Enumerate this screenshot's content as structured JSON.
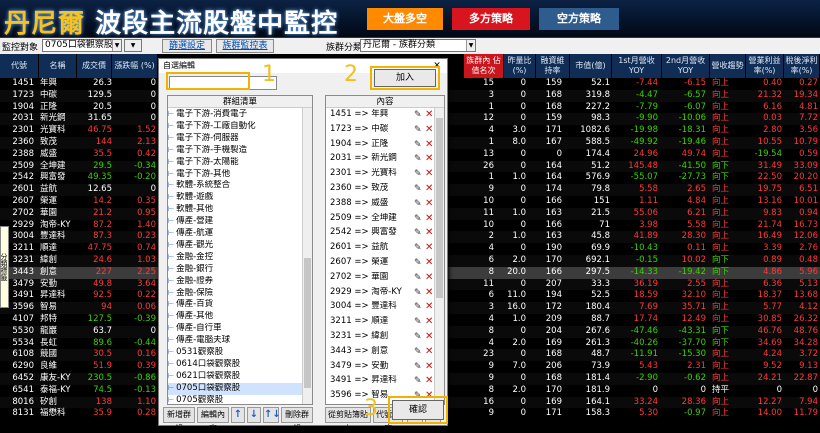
{
  "header": {
    "title_a": "丹尼爾",
    "title_b": "波段主流股盤中監控",
    "tab1": "大盤多空",
    "tab2": "多方策略",
    "tab3": "空方策略"
  },
  "toolbar": {
    "monitor_label": "監控對象",
    "monitor_value": "0705口袋觀察股",
    "btn1": "篩選設定",
    "btn2": "族群監控表",
    "group_label": "族群分類",
    "group_value": "丹尼爾 - 族群分類"
  },
  "columns": {
    "code": "代號",
    "name": "名稱",
    "price": "成交價",
    "chg": "漲跌幅 (%)",
    "dialog_title": "族群內\n佔值名次",
    "c1": "昨量比 (%)",
    "c2": "融資維 持率",
    "c3": "市值(億)",
    "c4": "1st月營收 YOY",
    "c5": "2nd月營收 YOY",
    "c6": "營收趨勢",
    "c7": "營業利益 率(%)",
    "c8": "稅後淨利 率(%)"
  },
  "side_tab": "分類標籤",
  "stocks": [
    {
      "code": "1451",
      "name": "年興",
      "price": "26.3",
      "chg": "0",
      "cls": "wh",
      "rank": "15",
      "a": "0",
      "b": "159",
      "cap": "52.1",
      "y1": "-7.44",
      "y2": "-6.15",
      "trend": "向上",
      "op": "0.40",
      "np": "0.27",
      "y1c": "up",
      "y2c": "up",
      "opc": "up",
      "npc": "up"
    },
    {
      "code": "1723",
      "name": "中碳",
      "price": "129.5",
      "chg": "0",
      "cls": "wh",
      "rank": "3",
      "a": "0",
      "b": "168",
      "cap": "319.8",
      "y1": "-4.47",
      "y2": "-6.57",
      "trend": "向上",
      "op": "21.32",
      "np": "19.34",
      "y1c": "dn",
      "y2c": "dn",
      "opc": "up",
      "npc": "up"
    },
    {
      "code": "1904",
      "name": "正隆",
      "price": "20.5",
      "chg": "0",
      "cls": "wh",
      "rank": "1",
      "a": "0",
      "b": "168",
      "cap": "227.2",
      "y1": "-7.79",
      "y2": "-6.07",
      "trend": "向上",
      "op": "6.16",
      "np": "4.81",
      "y1c": "dn",
      "y2c": "dn",
      "opc": "up",
      "npc": "up"
    },
    {
      "code": "2031",
      "name": "新光鋼",
      "price": "31.65",
      "chg": "0",
      "cls": "wh",
      "rank": "12",
      "a": "0",
      "b": "159",
      "cap": "98.3",
      "y1": "-9.90",
      "y2": "-10.06",
      "trend": "向上",
      "op": "0.03",
      "np": "7.72",
      "y1c": "dn",
      "y2c": "dn",
      "opc": "up",
      "npc": "up"
    },
    {
      "code": "2301",
      "name": "光寶科",
      "price": "46.75",
      "chg": "1.52",
      "cls": "up",
      "rank": "4",
      "a": "3.0",
      "b": "171",
      "cap": "1082.6",
      "y1": "-19.98",
      "y2": "-18.31",
      "trend": "向上",
      "op": "2.80",
      "np": "3.56",
      "y1c": "dn",
      "y2c": "dn",
      "opc": "up",
      "npc": "up"
    },
    {
      "code": "2360",
      "name": "致茂",
      "price": "144",
      "chg": "2.13",
      "cls": "up",
      "rank": "1",
      "a": "8.0",
      "b": "167",
      "cap": "588.5",
      "y1": "-49.92",
      "y2": "-19.46",
      "trend": "向上",
      "op": "10.55",
      "np": "10.79",
      "y1c": "dn",
      "y2c": "dn",
      "opc": "up",
      "npc": "up"
    },
    {
      "code": "2388",
      "name": "威盛",
      "price": "35.5",
      "chg": "0.42",
      "cls": "up",
      "rank": "13",
      "a": "0",
      "b": "0",
      "cap": "174.4",
      "y1": "24.96",
      "y2": "49.74",
      "trend": "向上",
      "op": "-19.54",
      "np": "0.59",
      "y1c": "up",
      "y2c": "up",
      "opc": "dn",
      "npc": "up"
    },
    {
      "code": "2509",
      "name": "全坤建",
      "price": "29.5",
      "chg": "-0.34",
      "cls": "dn",
      "rank": "26",
      "a": "0",
      "b": "164",
      "cap": "51.2",
      "y1": "145.48",
      "y2": "-41.50",
      "trend": "向下",
      "op": "31.49",
      "np": "33.09",
      "y1c": "up",
      "y2c": "dn",
      "opc": "up",
      "npc": "up"
    },
    {
      "code": "2542",
      "name": "興富發",
      "price": "49.35",
      "chg": "-0.20",
      "cls": "dn",
      "rank": "1",
      "a": "1.0",
      "b": "164",
      "cap": "576.9",
      "y1": "-55.07",
      "y2": "-27.73",
      "trend": "向下",
      "op": "22.50",
      "np": "20.20",
      "y1c": "dn",
      "y2c": "dn",
      "opc": "up",
      "npc": "up"
    },
    {
      "code": "2601",
      "name": "益航",
      "price": "12.65",
      "chg": "0",
      "cls": "wh",
      "rank": "9",
      "a": "0",
      "b": "174",
      "cap": "79.8",
      "y1": "5.58",
      "y2": "2.65",
      "trend": "向上",
      "op": "19.75",
      "np": "6.51",
      "y1c": "up",
      "y2c": "up",
      "opc": "up",
      "npc": "up"
    },
    {
      "code": "2607",
      "name": "榮運",
      "price": "14.2",
      "chg": "0.35",
      "cls": "up",
      "rank": "10",
      "a": "0",
      "b": "166",
      "cap": "151",
      "y1": "1.11",
      "y2": "4.84",
      "trend": "向上",
      "op": "13.16",
      "np": "10.01",
      "y1c": "up",
      "y2c": "up",
      "opc": "up",
      "npc": "up"
    },
    {
      "code": "2702",
      "name": "華園",
      "price": "21.2",
      "chg": "0.95",
      "cls": "up",
      "rank": "11",
      "a": "1.0",
      "b": "163",
      "cap": "21.5",
      "y1": "55.06",
      "y2": "6.21",
      "trend": "向上",
      "op": "9.83",
      "np": "0.94",
      "y1c": "up",
      "y2c": "up",
      "opc": "up",
      "npc": "up"
    },
    {
      "code": "2929",
      "name": "淘帝-KY",
      "price": "87.2",
      "chg": "1.40",
      "cls": "up",
      "rank": "10",
      "a": "0",
      "b": "166",
      "cap": "71",
      "y1": "3.98",
      "y2": "5.58",
      "trend": "向上",
      "op": "21.74",
      "np": "16.73",
      "y1c": "up",
      "y2c": "up",
      "opc": "up",
      "npc": "up"
    },
    {
      "code": "3004",
      "name": "豐達科",
      "price": "87.3",
      "chg": "0.23",
      "cls": "up",
      "rank": "2",
      "a": "1.0",
      "b": "163",
      "cap": "45.8",
      "y1": "41.89",
      "y2": "28.30",
      "trend": "向上",
      "op": "16.49",
      "np": "12.06",
      "y1c": "up",
      "y2c": "up",
      "opc": "up",
      "npc": "up"
    },
    {
      "code": "3211",
      "name": "順達",
      "price": "47.75",
      "chg": "0.74",
      "cls": "up",
      "rank": "4",
      "a": "0",
      "b": "190",
      "cap": "69.9",
      "y1": "-10.43",
      "y2": "0.11",
      "trend": "向上",
      "op": "3.39",
      "np": "2.76",
      "y1c": "dn",
      "y2c": "up",
      "opc": "up",
      "npc": "up"
    },
    {
      "code": "3231",
      "name": "緯創",
      "price": "24.6",
      "chg": "1.03",
      "cls": "up",
      "rank": "6",
      "a": "2.0",
      "b": "170",
      "cap": "692.1",
      "y1": "-0.15",
      "y2": "10.02",
      "trend": "向下",
      "op": "0.89",
      "np": "0.48",
      "y1c": "dn",
      "y2c": "up",
      "opc": "up",
      "npc": "up"
    },
    {
      "code": "3443",
      "name": "創意",
      "price": "227",
      "chg": "2.25",
      "cls": "up",
      "rank": "8",
      "a": "20.0",
      "b": "166",
      "cap": "297.5",
      "y1": "-14.33",
      "y2": "-19.42",
      "trend": "向下",
      "op": "4.86",
      "np": "5.96",
      "y1c": "dn",
      "y2c": "dn",
      "opc": "up",
      "npc": "up",
      "hl": true
    },
    {
      "code": "3479",
      "name": "安勤",
      "price": "49.8",
      "chg": "3.64",
      "cls": "up",
      "rank": "11",
      "a": "0",
      "b": "207",
      "cap": "33.3",
      "y1": "36.19",
      "y2": "2.55",
      "trend": "向上",
      "op": "6.36",
      "np": "5.13",
      "y1c": "up",
      "y2c": "up",
      "opc": "up",
      "npc": "up"
    },
    {
      "code": "3491",
      "name": "昇達科",
      "price": "92.5",
      "chg": "0.22",
      "cls": "up",
      "rank": "6",
      "a": "11.0",
      "b": "194",
      "cap": "52.5",
      "y1": "18.59",
      "y2": "32.10",
      "trend": "向上",
      "op": "18.37",
      "np": "13.68",
      "y1c": "up",
      "y2c": "up",
      "opc": "up",
      "npc": "up"
    },
    {
      "code": "3596",
      "name": "智易",
      "price": "94",
      "chg": "0.06",
      "cls": "up",
      "rank": "3",
      "a": "16.0",
      "b": "172",
      "cap": "180.4",
      "y1": "7.69",
      "y2": "35.71",
      "trend": "向上",
      "op": "5.77",
      "np": "4.12",
      "y1c": "up",
      "y2c": "up",
      "opc": "up",
      "npc": "up"
    },
    {
      "code": "4107",
      "name": "邦特",
      "price": "127.5",
      "chg": "-0.39",
      "cls": "dn",
      "rank": "4",
      "a": "1.0",
      "b": "209",
      "cap": "88.7",
      "y1": "17.74",
      "y2": "12.49",
      "trend": "向上",
      "op": "30.85",
      "np": "26.32",
      "y1c": "up",
      "y2c": "up",
      "opc": "up",
      "npc": "up"
    },
    {
      "code": "5530",
      "name": "龍巖",
      "price": "63.7",
      "chg": "0",
      "cls": "wh",
      "rank": "8",
      "a": "0",
      "b": "204",
      "cap": "267.6",
      "y1": "-47.46",
      "y2": "-43.31",
      "trend": "向下",
      "op": "46.76",
      "np": "48.76",
      "y1c": "dn",
      "y2c": "dn",
      "opc": "up",
      "npc": "up"
    },
    {
      "code": "5534",
      "name": "長虹",
      "price": "89.6",
      "chg": "-0.44",
      "cls": "dn",
      "rank": "4",
      "a": "2.0",
      "b": "169",
      "cap": "261.3",
      "y1": "-40.26",
      "y2": "-37.70",
      "trend": "向下",
      "op": "34.69",
      "np": "34.28",
      "y1c": "dn",
      "y2c": "dn",
      "opc": "up",
      "npc": "up"
    },
    {
      "code": "6108",
      "name": "競國",
      "price": "30.5",
      "chg": "0.16",
      "cls": "up",
      "rank": "23",
      "a": "0",
      "b": "168",
      "cap": "48.7",
      "y1": "-11.91",
      "y2": "-15.30",
      "trend": "向上",
      "op": "4.24",
      "np": "3.72",
      "y1c": "dn",
      "y2c": "dn",
      "opc": "up",
      "npc": "up"
    },
    {
      "code": "6290",
      "name": "良維",
      "price": "51.9",
      "chg": "0.39",
      "cls": "up",
      "rank": "9",
      "a": "7.0",
      "b": "206",
      "cap": "73.9",
      "y1": "5.43",
      "y2": "2.31",
      "trend": "向上",
      "op": "9.52",
      "np": "9.13",
      "y1c": "up",
      "y2c": "up",
      "opc": "up",
      "npc": "up"
    },
    {
      "code": "6452",
      "name": "康友-KY",
      "price": "230.5",
      "chg": "-0.86",
      "cls": "dn",
      "rank": "9",
      "a": "0",
      "b": "168",
      "cap": "181.4",
      "y1": "-2.90",
      "y2": "-0.62",
      "trend": "向上",
      "op": "24.21",
      "np": "22.87",
      "y1c": "dn",
      "y2c": "dn",
      "opc": "up",
      "npc": "up"
    },
    {
      "code": "6541",
      "name": "泰福-KY",
      "price": "74.5",
      "chg": "-0.13",
      "cls": "dn",
      "rank": "8",
      "a": "2.0",
      "b": "170",
      "cap": "181.9",
      "y1": "0",
      "y2": "0",
      "trend": "持平",
      "op": "0",
      "np": "0",
      "y1c": "wh",
      "y2c": "wh",
      "opc": "wh",
      "npc": "wh"
    },
    {
      "code": "8016",
      "name": "矽創",
      "price": "138",
      "chg": "1.10",
      "cls": "up",
      "rank": "16",
      "a": "0",
      "b": "169",
      "cap": "164.1",
      "y1": "33.24",
      "y2": "28.36",
      "trend": "向上",
      "op": "12.27",
      "np": "7.94",
      "y1c": "up",
      "y2c": "up",
      "opc": "up",
      "npc": "up"
    },
    {
      "code": "8131",
      "name": "福懋科",
      "price": "35.9",
      "chg": "0.28",
      "cls": "up",
      "rank": "9",
      "a": "0",
      "b": "171",
      "cap": "158.3",
      "y1": "5.30",
      "y2": "-0.97",
      "trend": "向上",
      "op": "14.00",
      "np": "11.79",
      "y1c": "up",
      "y2c": "dn",
      "opc": "up",
      "npc": "up"
    }
  ],
  "dialog": {
    "caption": "自選編輯",
    "close": "✕",
    "add_btn": "加入",
    "ok_btn": "確認",
    "left_header": "群組清單",
    "right_header": "內容",
    "groups": [
      "電子下游-消費電子",
      "電子下游-工廠自動化",
      "電子下游-伺服器",
      "電子下游-手機製造",
      "電子下游-太陽能",
      "電子下游-其他",
      "軟體-系統整合",
      "軟體-遊戲",
      "軟體-其他",
      "傳產-營建",
      "傳產-航運",
      "傳產-觀光",
      "金融-金控",
      "金融-銀行",
      "金融-證券",
      "金融-保險",
      "傳產-百貨",
      "傳產-其他",
      "傳產-自行車",
      "傳產-電腦夫球",
      "0531觀察股",
      "0614口袋觀察股",
      "0621口袋觀察股",
      "0705口袋觀察股",
      "0705觀察股"
    ],
    "selected_group": 23,
    "contents": [
      "1451 => 年興",
      "1723 => 中碳",
      "1904 => 正隆",
      "2031 => 新光鋼",
      "2301 => 光寶科",
      "2360 => 致茂",
      "2388 => 威盛",
      "2509 => 全坤建",
      "2542 => 興富發",
      "2601 => 益航",
      "2607 => 榮運",
      "2702 => 華園",
      "2929 => 淘帝-KY",
      "3004 => 豐達科",
      "3211 => 順達",
      "3231 => 緯創",
      "3443 => 創意",
      "3479 => 安勤",
      "3491 => 昇達科",
      "3596 => 智易"
    ],
    "buttons_left": [
      "新增群組",
      "編輯內容",
      "↑",
      "↓",
      "↑↓",
      "刪除群組"
    ],
    "buttons_right": [
      "從剪貼簿貼上",
      "代號排序",
      "↑",
      "↓"
    ],
    "markers": [
      "1",
      "2",
      "3"
    ]
  }
}
